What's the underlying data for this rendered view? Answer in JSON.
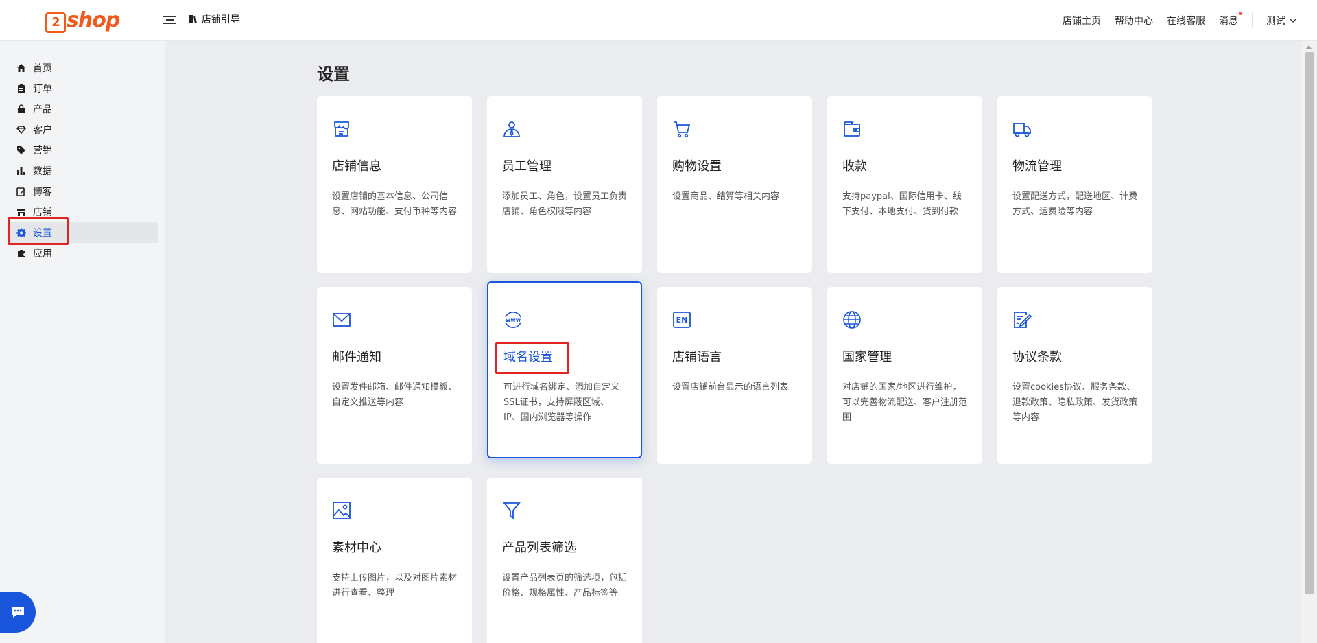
{
  "app": {
    "logo_text": "2shop"
  },
  "header": {
    "guide_label": "店铺引导",
    "links": {
      "store_home": "店铺主页",
      "help_center": "帮助中心",
      "online_support": "在线客服",
      "messages": "消息"
    },
    "user_name": "测试"
  },
  "sidebar": {
    "items": [
      {
        "label": "首页",
        "icon": "home-icon"
      },
      {
        "label": "订单",
        "icon": "clipboard-icon"
      },
      {
        "label": "产品",
        "icon": "bag-icon"
      },
      {
        "label": "客户",
        "icon": "diamond-icon"
      },
      {
        "label": "营销",
        "icon": "tag-icon"
      },
      {
        "label": "数据",
        "icon": "bar-chart-icon"
      },
      {
        "label": "博客",
        "icon": "edit-icon"
      },
      {
        "label": "店铺",
        "icon": "store-icon"
      },
      {
        "label": "设置",
        "icon": "gear-icon",
        "active": true
      },
      {
        "label": "应用",
        "icon": "puzzle-icon"
      }
    ]
  },
  "main": {
    "title": "设置",
    "cards": [
      {
        "title": "店铺信息",
        "desc": "设置店铺的基本信息、公司信息、网站功能、支付币种等内容",
        "icon": "storefront-icon"
      },
      {
        "title": "员工管理",
        "desc": "添加员工、角色，设置员工负责店铺、角色权限等内容",
        "icon": "staff-icon"
      },
      {
        "title": "购物设置",
        "desc": "设置商品、结算等相关内容",
        "icon": "cart-icon"
      },
      {
        "title": "收款",
        "desc": "支持paypal、国际信用卡、线下支付、本地支付、货到付款",
        "icon": "wallet-icon"
      },
      {
        "title": "物流管理",
        "desc": "设置配送方式，配送地区、计费方式、运费险等内容",
        "icon": "truck-icon"
      },
      {
        "title": "邮件通知",
        "desc": "设置发件邮箱、邮件通知模板、自定义推送等内容",
        "icon": "mail-icon"
      },
      {
        "title": "域名设置",
        "desc": "可进行域名绑定、添加自定义SSL证书，支持屏蔽区域、IP、国内浏览器等操作",
        "icon": "www-icon",
        "selected": true
      },
      {
        "title": "店铺语言",
        "desc": "设置店铺前台显示的语言列表",
        "icon": "en-language-icon"
      },
      {
        "title": "国家管理",
        "desc": "对店铺的国家/地区进行维护，可以完善物流配送、客户注册范围",
        "icon": "globe-icon"
      },
      {
        "title": "协议条款",
        "desc": "设置cookies协议、服务条款、退款政策、隐私政策、发货政策等内容",
        "icon": "document-sign-icon"
      },
      {
        "title": "素材中心",
        "desc": "支持上传图片，以及对图片素材进行查看、整理",
        "icon": "image-icon"
      },
      {
        "title": "产品列表筛选",
        "desc": "设置产品列表页的筛选项，包括价格、规格属性、产品标签等",
        "icon": "filter-icon"
      }
    ]
  },
  "colors": {
    "accent": "#1a56db",
    "brand": "#f05a1a",
    "highlight": "#e02424"
  }
}
